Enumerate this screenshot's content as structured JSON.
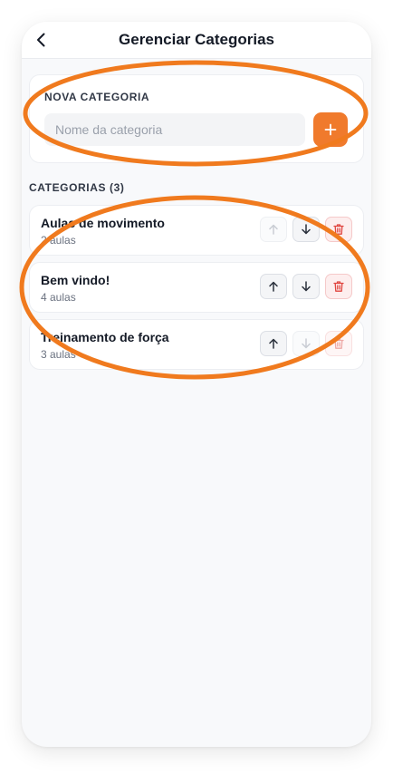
{
  "header": {
    "title": "Gerenciar Categorias",
    "back_icon": "chevron-left-icon"
  },
  "new_category": {
    "section_label": "NOVA CATEGORIA",
    "input_value": "",
    "input_placeholder": "Nome da categoria",
    "add_button_icon": "plus-icon"
  },
  "categories": {
    "section_label": "CATEGORIAS (3)",
    "items": [
      {
        "name": "Aulas de movimento",
        "subtitle": "2 aulas",
        "up_enabled": false,
        "down_enabled": true,
        "delete_enabled": true
      },
      {
        "name": "Bem vindo!",
        "subtitle": "4 aulas",
        "up_enabled": true,
        "down_enabled": true,
        "delete_enabled": true
      },
      {
        "name": "Treinamento de força",
        "subtitle": "3 aulas",
        "up_enabled": true,
        "down_enabled": false,
        "delete_enabled": true
      }
    ]
  },
  "colors": {
    "accent": "#f07a2c",
    "annotation": "#f07a1e",
    "delete": "#e0453f",
    "text_primary": "#141a26",
    "text_secondary": "#6b7280"
  }
}
